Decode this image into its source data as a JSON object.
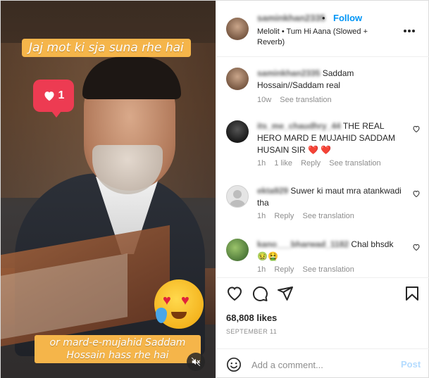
{
  "media": {
    "caption_top": "Jaj mot ki sja suna rhe hai",
    "caption_bottom": "or mard-e-mujahid Saddam Hossain hass rhe hai",
    "like_count": "1",
    "mute_icon": "speaker-muted-icon"
  },
  "header": {
    "username": "saminkhan2335",
    "dot": "•",
    "follow_label": "Follow",
    "audio": "Melolit • Tum Hi Aana (Slowed + Reverb)",
    "more_icon": "more-horizontal-icon"
  },
  "comments": [
    {
      "username": "saminkhan2335",
      "text": "Saddam Hossain//Saddam real",
      "time": "10w",
      "likes": "",
      "reply": "",
      "translate": "See translation"
    },
    {
      "username": "its_me_chaudhry_44",
      "text": "THE REAL HERO MARD E MUJAHID SADDAM HUSAIN SIR ❤️ ❤️",
      "time": "1h",
      "likes": "1 like",
      "reply": "Reply",
      "translate": "See translation"
    },
    {
      "username": "ekta929",
      "text": "Suwer ki maut mra atankwadi tha",
      "time": "1h",
      "likes": "",
      "reply": "Reply",
      "translate": "See translation"
    },
    {
      "username": "kano___bharwad_1182",
      "text": "Chal bhsdk 🤢🤮",
      "time": "1h",
      "likes": "",
      "reply": "Reply",
      "translate": "See translation"
    }
  ],
  "actions": {
    "likes": "68,808 likes",
    "date": "SEPTEMBER 11"
  },
  "add_comment": {
    "placeholder": "Add a comment...",
    "post_label": "Post"
  },
  "colors": {
    "accent": "#0095f6",
    "caption_bg": "#f5b54a",
    "like_bubble": "#ed3b52",
    "post_disabled": "#b3dbff"
  }
}
